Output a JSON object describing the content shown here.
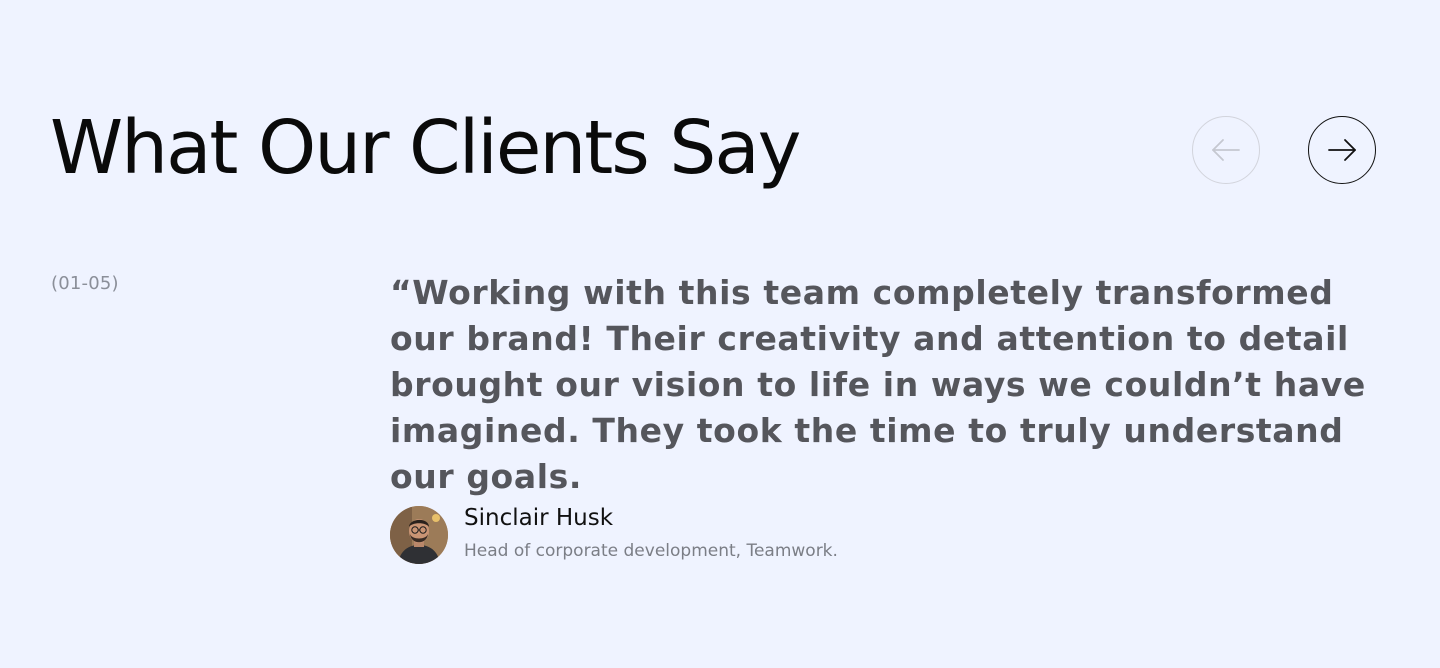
{
  "section": {
    "title": "What Our Clients Say"
  },
  "navigation": {
    "prev_icon": "arrow-left-icon",
    "next_icon": "arrow-right-icon",
    "prev_state": "disabled",
    "next_state": "enabled"
  },
  "testimonial": {
    "counter": "(01-05)",
    "quote": "“Working with this team completely transformed our brand! Their creativity and attention to detail brought our vision to life in ways we couldn’t have imagined. They took the time to truly understand our goals.",
    "author": {
      "name": "Sinclair Husk",
      "title": "Head of corporate development, Teamwork."
    }
  },
  "colors": {
    "background": "#eff3ff",
    "heading": "#0a0a0a",
    "quote": "#55565c",
    "muted": "#8b8f99",
    "disabled_border": "#d2d4dc",
    "active_border": "#111111"
  }
}
